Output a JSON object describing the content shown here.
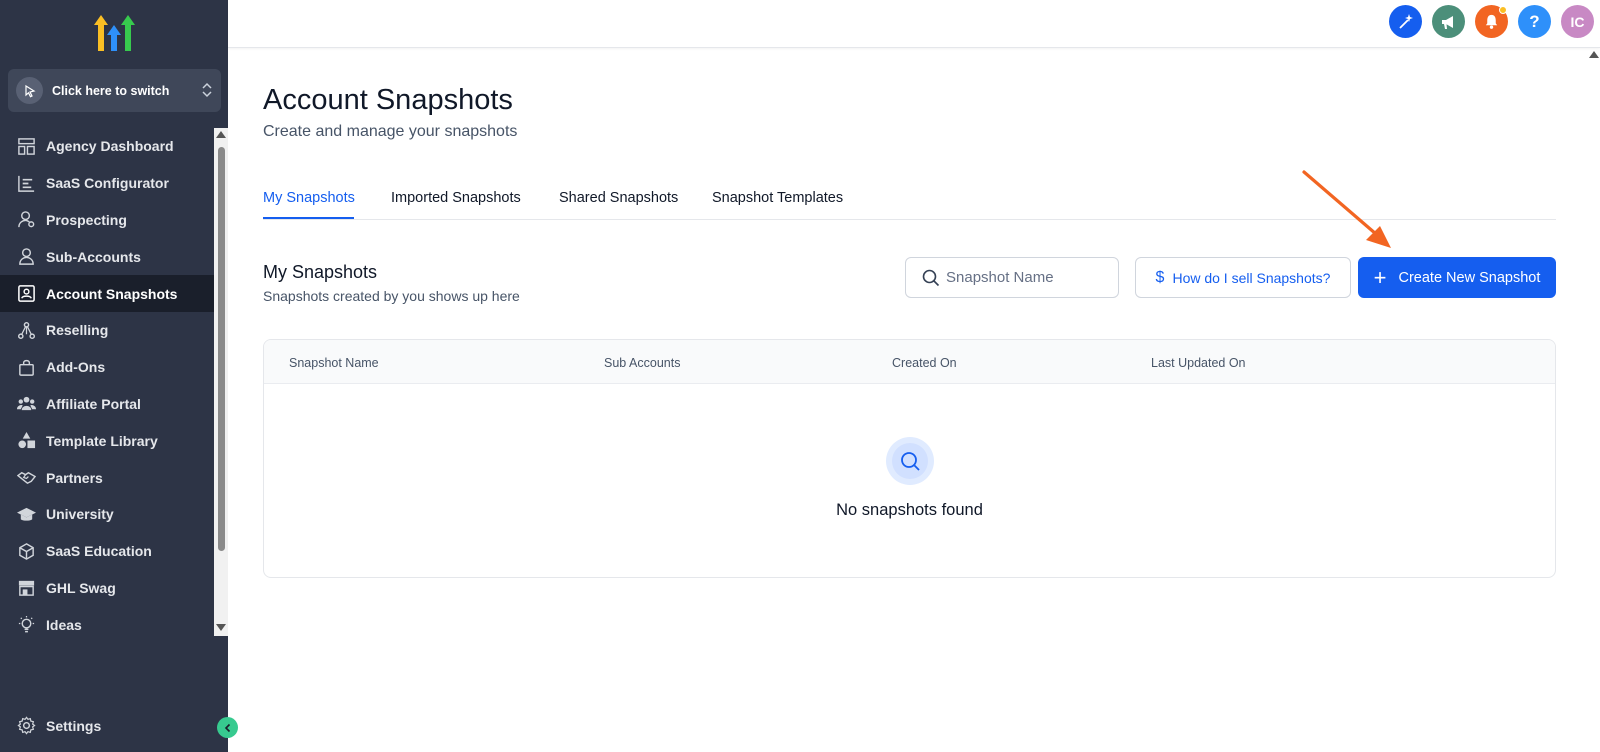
{
  "brand": {
    "accent": "#155eef",
    "sidebar_bg": "#2d3446",
    "arrow_color": "#f26522"
  },
  "sidebar": {
    "logo_icon": "highlevel-arrows-logo",
    "switcher_label": "Click here to switch",
    "items": [
      {
        "label": "Agency Dashboard",
        "icon": "dashboard-icon"
      },
      {
        "label": "SaaS Configurator",
        "icon": "chart-icon"
      },
      {
        "label": "Prospecting",
        "icon": "prospect-user-icon"
      },
      {
        "label": "Sub-Accounts",
        "icon": "user-icon"
      },
      {
        "label": "Account Snapshots",
        "icon": "snapshot-icon",
        "active": true
      },
      {
        "label": "Reselling",
        "icon": "network-icon"
      },
      {
        "label": "Add-Ons",
        "icon": "shopping-bag-icon"
      },
      {
        "label": "Affiliate Portal",
        "icon": "users-icon"
      },
      {
        "label": "Template Library",
        "icon": "shapes-icon"
      },
      {
        "label": "Partners",
        "icon": "handshake-icon"
      },
      {
        "label": "University",
        "icon": "graduation-cap-icon"
      },
      {
        "label": "SaaS Education",
        "icon": "cube-icon"
      },
      {
        "label": "GHL Swag",
        "icon": "store-icon"
      },
      {
        "label": "Ideas",
        "icon": "lightbulb-icon"
      }
    ],
    "settings_label": "Settings"
  },
  "topbar": {
    "icons": [
      {
        "name": "ai-sparkle-icon",
        "color": "#155eef"
      },
      {
        "name": "megaphone-icon",
        "color": "#4c8f7a"
      },
      {
        "name": "bell-icon",
        "color": "#f26522"
      },
      {
        "name": "help-icon",
        "color": "#2e90fa",
        "glyph": "?"
      },
      {
        "name": "avatar",
        "color": "#c889c4",
        "glyph": "IC"
      }
    ]
  },
  "page": {
    "title": "Account Snapshots",
    "subtitle": "Create and manage your snapshots"
  },
  "tabs": [
    {
      "label": "My Snapshots",
      "active": true
    },
    {
      "label": "Imported Snapshots"
    },
    {
      "label": "Shared Snapshots"
    },
    {
      "label": "Snapshot Templates"
    }
  ],
  "section": {
    "title": "My Snapshots",
    "subtitle": "Snapshots created by you shows up here"
  },
  "search": {
    "placeholder": "Snapshot Name",
    "value": ""
  },
  "buttons": {
    "how_label": "How do I sell Snapshots?",
    "create_label": "Create New Snapshot"
  },
  "table": {
    "columns": [
      "Snapshot Name",
      "Sub Accounts",
      "Created On",
      "Last Updated On"
    ],
    "rows": [],
    "empty_text": "No snapshots found"
  }
}
